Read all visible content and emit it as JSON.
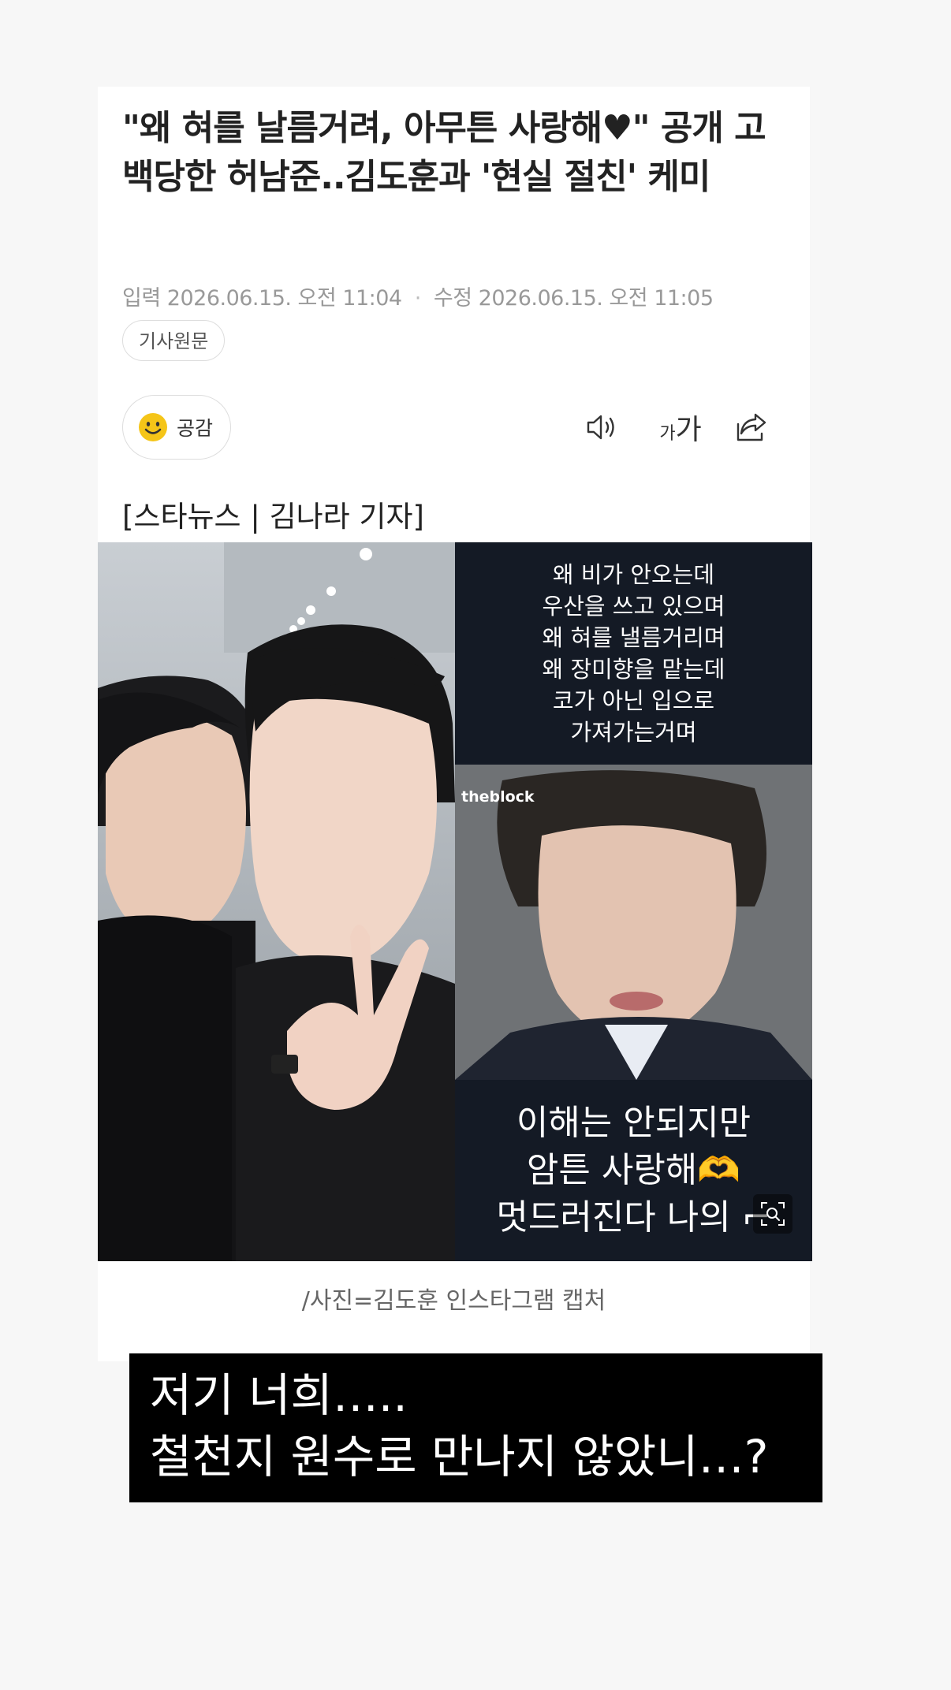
{
  "article": {
    "headline": "\"왜 혀를 날름거려, 아무튼 사랑해♥\" 공개 고백당한 허남준..김도훈과 '현실 절친' 케미",
    "meta": {
      "input_label": "입력",
      "input_date": "2026.06.15. 오전 11:04",
      "modified_label": "수정",
      "modified_date": "2026.06.15. 오전 11:05"
    },
    "source_button": "기사원문",
    "empathy_button": "공감",
    "toolbar": {
      "speaker_icon": "speaker-icon",
      "font_icon": "font-size-icon",
      "font_small": "가",
      "font_large": "가",
      "share_icon": "share-icon"
    },
    "byline": "[스타뉴스 | 김나라 기자]",
    "photo": {
      "top_text": [
        "왜 비가 안오는데",
        "우산을 쓰고 있으며",
        "왜 혀를 낼름거리며",
        "왜 장미향을 맡는데",
        "코가 아닌 입으로",
        "가져가는거며"
      ],
      "watermark": "theblock",
      "bottom_text": [
        "이해는 안되지만",
        "암튼 사랑해🫶",
        "멋드러진다 나의 ⌐"
      ]
    },
    "caption": "/사진=김도훈 인스타그램 캡처"
  },
  "overlay": {
    "line1": "저기 너희…..",
    "line2": "철천지 원수로 만나지 않았니…?"
  },
  "colors": {
    "page_bg": "#f7f7f7",
    "panel_bg": "#141a25",
    "emoji_yellow": "#f5c518"
  }
}
